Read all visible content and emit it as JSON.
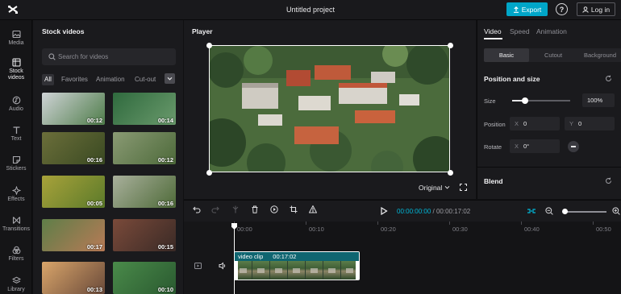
{
  "app": {
    "doc_title": "Untitled project",
    "export_label": "Export",
    "help_label": "?",
    "login_label": "Log in"
  },
  "rail": [
    {
      "label": "Media",
      "icon": "media-icon"
    },
    {
      "label": "Stock videos",
      "icon": "stock-videos-icon",
      "active": true
    },
    {
      "label": "Audio",
      "icon": "audio-icon"
    },
    {
      "label": "Text",
      "icon": "text-icon"
    },
    {
      "label": "Stickers",
      "icon": "stickers-icon"
    },
    {
      "label": "Effects",
      "icon": "effects-icon"
    },
    {
      "label": "Transitions",
      "icon": "transitions-icon"
    },
    {
      "label": "Filters",
      "icon": "filters-icon"
    },
    {
      "label": "Library",
      "icon": "library-icon"
    }
  ],
  "stock": {
    "title": "Stock videos",
    "search_placeholder": "Search for videos",
    "filters": [
      "All",
      "Favorites",
      "Animation",
      "Cut-out"
    ],
    "active_filter": "All",
    "thumbs": [
      {
        "dur": "00:12",
        "palette": [
          "#cfd3d6",
          "#4f7d4a"
        ]
      },
      {
        "dur": "00:14",
        "palette": [
          "#2f6a3e",
          "#6a9a6c"
        ]
      },
      {
        "dur": "00:16",
        "palette": [
          "#6b6e3a",
          "#3a4a22"
        ]
      },
      {
        "dur": "00:12",
        "palette": [
          "#8a9a74",
          "#4d6a3a"
        ]
      },
      {
        "dur": "00:05",
        "palette": [
          "#a8a23a",
          "#5b7a2a"
        ]
      },
      {
        "dur": "00:16",
        "palette": [
          "#a9b09c",
          "#4e6a38"
        ]
      },
      {
        "dur": "00:17",
        "palette": [
          "#5e7e48",
          "#b87a56"
        ]
      },
      {
        "dur": "00:15",
        "palette": [
          "#7a4a3a",
          "#3a2a26"
        ]
      },
      {
        "dur": "00:13",
        "palette": [
          "#d9a56a",
          "#6a4a3a"
        ]
      },
      {
        "dur": "00:10",
        "palette": [
          "#4a8a4a",
          "#2a5a30"
        ]
      }
    ]
  },
  "player": {
    "title": "Player",
    "ratio_label": "Original"
  },
  "props": {
    "tabs": [
      "Video",
      "Speed",
      "Animation"
    ],
    "subtabs": [
      "Basic",
      "Cutout",
      "Background"
    ],
    "position_title": "Position and size",
    "size_label": "Size",
    "size_value": "100%",
    "size_fraction": 0.22,
    "position_label": "Position",
    "pos_x_tag": "X",
    "pos_x": "0",
    "pos_y_tag": "Y",
    "pos_y": "0",
    "rotate_label": "Rotate",
    "rot_tag": "X",
    "rot_value": "0°",
    "blend_title": "Blend"
  },
  "timeline": {
    "time_current": "00:00:00:00",
    "time_separator": "/",
    "time_total": "00:00:17:02",
    "ruler": [
      "00:00",
      "00:10",
      "00:20",
      "00:30",
      "00:40",
      "00:50"
    ],
    "clip_name": "video clip",
    "clip_duration": "00:17:02",
    "zoom_fraction": 0.0
  }
}
